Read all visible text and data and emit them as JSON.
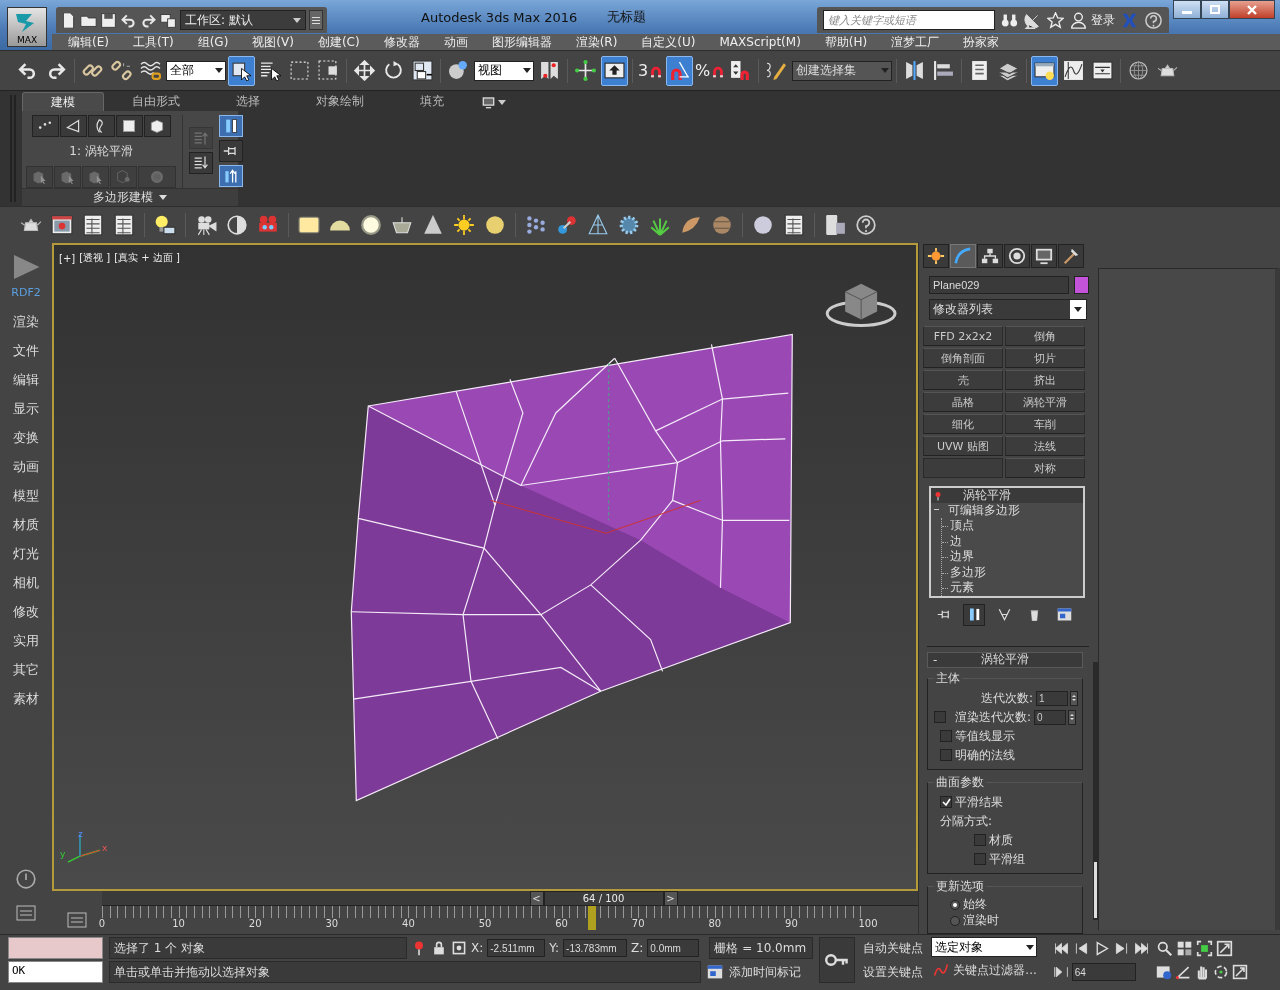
{
  "window": {
    "app_button": "MAX",
    "title": "Autodesk 3ds Max 2016",
    "document": "无标题",
    "workspace": "工作区: 默认"
  },
  "search": {
    "placeholder": "键入关键字或短语"
  },
  "login": "登录",
  "menu": [
    "编辑(E)",
    "工具(T)",
    "组(G)",
    "视图(V)",
    "创建(C)",
    "修改器",
    "动画",
    "图形编辑器",
    "渲染(R)",
    "自定义(U)",
    "MAXScript(M)",
    "帮助(H)",
    "渲梦工厂",
    "扮家家"
  ],
  "main_toolbar": [
    {
      "kind": "undo",
      "active": false
    },
    {
      "kind": "redo",
      "active": false
    },
    {
      "kind": "separator"
    },
    {
      "kind": "link",
      "active": false
    },
    {
      "kind": "unlink",
      "active": false
    },
    {
      "kind": "bind",
      "active": false
    },
    {
      "kind": "dropdown",
      "value": "全部"
    },
    {
      "kind": "select",
      "active": true
    },
    {
      "kind": "selname",
      "active": false
    },
    {
      "kind": "rect",
      "active": false
    },
    {
      "kind": "window",
      "active": false
    },
    {
      "kind": "separator"
    },
    {
      "kind": "move",
      "active": false
    },
    {
      "kind": "rotate",
      "active": false
    },
    {
      "kind": "scale",
      "active": false
    },
    {
      "kind": "separator"
    },
    {
      "kind": "sphere",
      "active": false
    },
    {
      "kind": "dropdown",
      "value": "视图"
    },
    {
      "kind": "pivot",
      "active": false
    },
    {
      "kind": "separator"
    },
    {
      "kind": "crosshair",
      "active": false
    },
    {
      "kind": "keyboard",
      "active": true
    },
    {
      "kind": "separator"
    },
    {
      "kind": "snap",
      "label": "3",
      "active": false
    },
    {
      "kind": "angle",
      "active": true
    },
    {
      "kind": "snap",
      "label": "%",
      "active": false
    },
    {
      "kind": "spinner",
      "active": false
    },
    {
      "kind": "separator"
    },
    {
      "kind": "pencil",
      "active": false
    },
    {
      "kind": "dropdown",
      "value": "创建选择集"
    },
    {
      "kind": "separator"
    },
    {
      "kind": "mirror",
      "active": false
    },
    {
      "kind": "align",
      "active": false
    },
    {
      "kind": "separator"
    },
    {
      "kind": "list",
      "active": false
    },
    {
      "kind": "layers",
      "active": false
    },
    {
      "kind": "separator"
    },
    {
      "kind": "explorer",
      "active": true
    },
    {
      "kind": "curve",
      "active": false
    },
    {
      "kind": "schematic",
      "active": false
    },
    {
      "kind": "separator"
    },
    {
      "kind": "checker",
      "active": false
    },
    {
      "kind": "teapot",
      "active": false
    }
  ],
  "ribbon": {
    "tabs": [
      {
        "label": "建模",
        "selected": true
      },
      {
        "label": "自由形式",
        "selected": false
      },
      {
        "label": "选择",
        "selected": false
      },
      {
        "label": "对象绘制",
        "selected": false
      },
      {
        "label": "填充",
        "selected": false
      }
    ],
    "stack_label": "1: 涡轮平滑",
    "panel_title": "多边形建模",
    "selection_tools_disabled": true,
    "stack_tools": [
      {
        "kind": "up",
        "disabled": true
      },
      {
        "kind": "down",
        "disabled": false
      }
    ],
    "pin_tools": [
      {
        "kind": "showend",
        "active": true
      },
      {
        "kind": "pin",
        "active": false
      },
      {
        "kind": "showall",
        "active": true
      }
    ]
  },
  "sidebar": {
    "title": "RDF2",
    "items": [
      "渲染",
      "文件",
      "编辑",
      "显示",
      "变换",
      "动画",
      "模型",
      "材质",
      "灯光",
      "相机",
      "修改",
      "实用",
      "其它",
      "素材"
    ]
  },
  "viewport": {
    "labels": [
      "[+]",
      "[透视 ]",
      "[真实 + 边面 ]"
    ],
    "axes": [
      "z",
      "y",
      "x"
    ]
  },
  "command_panel": {
    "tabs": [
      {
        "kind": "create",
        "selected": false
      },
      {
        "kind": "modify",
        "selected": true
      },
      {
        "kind": "hierarchy",
        "selected": false
      },
      {
        "kind": "motion",
        "selected": false
      },
      {
        "kind": "display",
        "selected": false
      },
      {
        "kind": "utilities",
        "selected": false
      }
    ],
    "object_name": "Plane029",
    "modifier_list": "修改器列表",
    "modifier_buttons": [
      {
        "left": "FFD 2x2x2",
        "right": "倒角"
      },
      {
        "left": "倒角剖面",
        "right": "切片"
      },
      {
        "left": "壳",
        "right": "挤出"
      },
      {
        "left": "晶格",
        "right": "涡轮平滑"
      },
      {
        "left": "细化",
        "right": "车削"
      },
      {
        "left": "UVW 贴图",
        "right": "法线"
      },
      {
        "right": "对称"
      }
    ],
    "stack": [
      {
        "label": "涡轮平滑",
        "selected": true,
        "expanded": false
      },
      {
        "label": "可编辑多边形",
        "selected": false,
        "expanded": true,
        "children": [
          {
            "label": "顶点"
          },
          {
            "label": "边"
          },
          {
            "label": "边界"
          },
          {
            "label": "多边形"
          },
          {
            "label": "元素"
          }
        ]
      }
    ],
    "stack_toolbar": [
      {
        "kind": "pin",
        "active": false
      },
      {
        "kind": "showend",
        "active": true
      },
      {
        "kind": "unique",
        "active": false
      },
      {
        "kind": "remove",
        "active": false
      },
      {
        "kind": "config",
        "active": false
      }
    ],
    "rollout": {
      "title": "涡轮平滑",
      "collapse": "-",
      "groups": [
        {
          "title": "主体",
          "rows": [
            {
              "kind": "spinner",
              "label": "迭代次数:",
              "value": "1"
            },
            {
              "kind": "checkspinner",
              "label": "渲染迭代次数:",
              "value": "0",
              "checked": false
            },
            {
              "kind": "checkbox",
              "label": "等值线显示",
              "checked": false
            },
            {
              "kind": "checkbox",
              "label": "明确的法线",
              "checked": false
            }
          ]
        },
        {
          "title": "曲面参数",
          "rows": [
            {
              "kind": "checkbox",
              "label": "平滑结果",
              "checked": true
            },
            {
              "kind": "text",
              "label": "分隔方式:"
            },
            {
              "kind": "subcheck",
              "label": "材质",
              "checked": false
            },
            {
              "kind": "subcheck",
              "label": "平滑组",
              "checked": false
            }
          ]
        },
        {
          "title": "更新选项",
          "rows": [
            {
              "kind": "radio",
              "label": "始终",
              "selected": true
            },
            {
              "kind": "radio",
              "label": "渲染时",
              "selected": false
            }
          ]
        }
      ]
    }
  },
  "timeline": {
    "prev": "<",
    "next": ">",
    "position": "64 / 100",
    "level": 0.64,
    "ticks": [
      "0",
      "10",
      "20",
      "30",
      "40",
      "50",
      "60",
      "70",
      "80",
      "90",
      "100"
    ]
  },
  "status_bar": {
    "listener_output": "OK",
    "selection": "选择了 1 个 对象",
    "prompt": "单击或单击并拖动以选择对象",
    "x_label": "X:",
    "x": "-2.511mm",
    "y_label": "Y:",
    "y": "-13.783mm",
    "z_label": "Z:",
    "z": "0.0mm",
    "grid": "栅格 = 10.0mm",
    "time_tag": "添加时间标记",
    "auto_key": "自动关键点",
    "set_key": "设置关键点",
    "key_mode": "选定对象",
    "key_filters": "关键点过滤器...",
    "frame": "64"
  }
}
